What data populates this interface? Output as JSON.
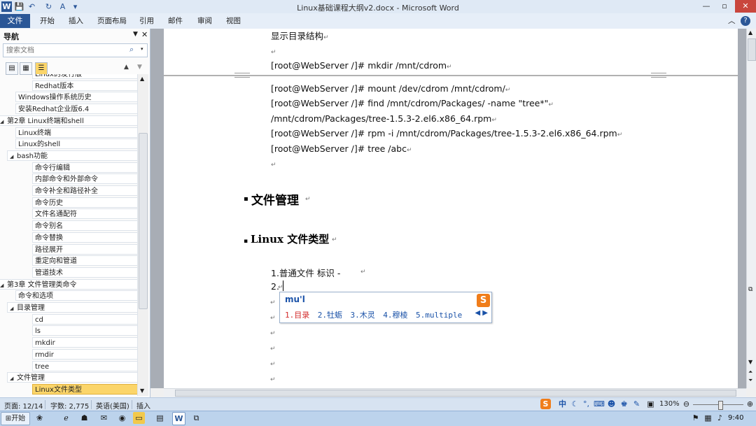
{
  "window": {
    "title": "Linux基础课程大纲v2.docx - Microsoft Word",
    "min": "—",
    "max": "▫",
    "close": "✕"
  },
  "quick_access": {
    "word": "W",
    "save": "💾",
    "undo": "↶",
    "redo": "↻",
    "format": "A",
    "more": "▾"
  },
  "ribbon": {
    "tabs": [
      "文件",
      "开始",
      "插入",
      "页面布局",
      "引用",
      "邮件",
      "审阅",
      "视图"
    ],
    "help": "?"
  },
  "nav": {
    "title": "导航",
    "search_placeholder": "搜索文档",
    "items": [
      {
        "label": "Linux的发行版",
        "level": 3
      },
      {
        "label": "Redhat版本",
        "level": 3
      },
      {
        "label": "Windows操作系统历史",
        "level": 2
      },
      {
        "label": "安装Redhat企业版6.4",
        "level": 2
      },
      {
        "label": "第2章 Linux终端和shell",
        "level": 1,
        "expanded": true
      },
      {
        "label": "Linux终端",
        "level": 2
      },
      {
        "label": "Linux的shell",
        "level": 2
      },
      {
        "label": "bash功能",
        "level": 2,
        "expanded": true
      },
      {
        "label": "命令行编辑",
        "level": 3
      },
      {
        "label": "内部命令和外部命令",
        "level": 3
      },
      {
        "label": "命令补全和路径补全",
        "level": 3
      },
      {
        "label": "命令历史",
        "level": 3
      },
      {
        "label": "文件名通配符",
        "level": 3
      },
      {
        "label": "命令别名",
        "level": 3
      },
      {
        "label": "命令替换",
        "level": 3
      },
      {
        "label": "路径展开",
        "level": 3
      },
      {
        "label": "重定向和管道",
        "level": 3
      },
      {
        "label": "管道技术",
        "level": 3
      },
      {
        "label": "第3章 文件管理类命令",
        "level": 1,
        "expanded": true
      },
      {
        "label": "命令和选项",
        "level": 2
      },
      {
        "label": "目录管理",
        "level": 2,
        "expanded": true
      },
      {
        "label": "cd",
        "level": 3
      },
      {
        "label": "ls",
        "level": 3
      },
      {
        "label": "mkdir",
        "level": 3
      },
      {
        "label": "rmdir",
        "level": 3
      },
      {
        "label": "tree",
        "level": 3
      },
      {
        "label": "文件管理",
        "level": 2,
        "expanded": true
      },
      {
        "label": "Linux文件类型",
        "level": 3,
        "selected": true
      }
    ]
  },
  "document": {
    "lines": [
      {
        "text": "显示目录结构"
      },
      {
        "text": ""
      },
      {
        "text": "[root@WebServer /]# mkdir /mnt/cdrom"
      },
      {
        "text": "[root@WebServer /]# mount /dev/cdrom /mnt/cdrom/"
      },
      {
        "text": "[root@WebServer /]# find /mnt/cdrom/Packages/ -name \"tree*\""
      },
      {
        "text": "/mnt/cdrom/Packages/tree-1.5.3-2.el6.x86_64.rpm"
      },
      {
        "text": "[root@WebServer /]# rpm -i /mnt/cdrom/Packages/tree-1.5.3-2.el6.x86_64.rpm"
      },
      {
        "text": "[root@WebServer /]# tree /abc"
      },
      {
        "text": ""
      }
    ],
    "heading1": "文件管理",
    "heading2": "Linux 文件类型",
    "list1": "1.普通文件      标识  -",
    "list2": "2.",
    "para_mark": "↵",
    "bullet": "▪"
  },
  "ime": {
    "input": "mu'l",
    "logo": "S",
    "candidates": [
      "1.目录",
      "2.牡蛎",
      "3.木灵",
      "4.穆棱",
      "5.multiple"
    ],
    "arrows": "◀ ▶"
  },
  "status": {
    "page": "页面: 12/14",
    "words": "字数: 2,775",
    "lang": "英语(美国)",
    "mode": "插入",
    "zoom": "130%",
    "ime_cn": "中"
  },
  "taskbar": {
    "start": "开始",
    "time": "9:40"
  }
}
